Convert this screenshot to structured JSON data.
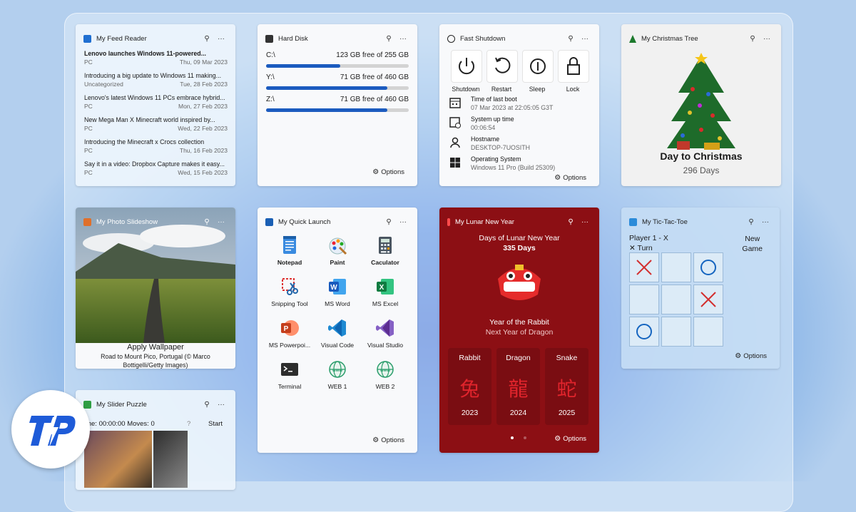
{
  "feed": {
    "title": "My Feed Reader",
    "items": [
      {
        "title": "Lenovo launches Windows 11-powered...",
        "cat": "PC",
        "date": "Thu, 09 Mar 2023"
      },
      {
        "title": "Introducing a big update to Windows 11 making...",
        "cat": "Uncategorized",
        "date": "Tue, 28 Feb 2023"
      },
      {
        "title": "Lenovo's latest Windows 11 PCs embrace hybrid...",
        "cat": "PC",
        "date": "Mon, 27 Feb 2023"
      },
      {
        "title": "New Mega Man X Minecraft world inspired by...",
        "cat": "PC",
        "date": "Wed, 22 Feb 2023"
      },
      {
        "title": "Introducing the Minecraft x Crocs collection",
        "cat": "PC",
        "date": "Thu, 16 Feb 2023"
      },
      {
        "title": "Say it in a video: Dropbox Capture makes it easy...",
        "cat": "PC",
        "date": "Wed, 15 Feb 2023"
      }
    ]
  },
  "disk": {
    "title": "Hard Disk",
    "drives": [
      {
        "name": "C:\\",
        "free": "123 GB free of 255 GB",
        "used_fraction": 0.52
      },
      {
        "name": "Y:\\",
        "free": "71 GB free of 460 GB",
        "used_fraction": 0.85
      },
      {
        "name": "Z:\\",
        "free": "71 GB free of 460 GB",
        "used_fraction": 0.85
      }
    ],
    "options": "Options"
  },
  "shutdown": {
    "title": "Fast Shutdown",
    "buttons": [
      "Shutdown",
      "Restart",
      "Sleep",
      "Lock"
    ],
    "info": [
      {
        "key": "Time of last boot",
        "value": "07 Mar 2023 at 22:05:05 G3T"
      },
      {
        "key": "System up time",
        "value": "00:06:54"
      },
      {
        "key": "Hostname",
        "value": "DESKTOP-7UOSITH"
      },
      {
        "key": "Operating System",
        "value": "Windows 11 Pro (Build 25309)"
      }
    ],
    "options": "Options"
  },
  "xmas": {
    "title": "My Christmas Tree",
    "label": "Day to Christmas",
    "days": "296 Days"
  },
  "slideshow": {
    "title": "My Photo Slideshow",
    "action": "Apply Wallpaper",
    "caption": "Road to Mount Pico, Portugal (© Marco Bottigelli/Getty Images)"
  },
  "launch": {
    "title": "My Quick Launch",
    "apps": [
      {
        "label": "Notepad",
        "icon": "notepad-icon"
      },
      {
        "label": "Paint",
        "icon": "paint-icon"
      },
      {
        "label": "Caculator",
        "icon": "calculator-icon"
      },
      {
        "label": "Snipping Tool",
        "icon": "snipping-tool-icon"
      },
      {
        "label": "MS Word",
        "icon": "word-icon"
      },
      {
        "label": "MS Excel",
        "icon": "excel-icon"
      },
      {
        "label": "MS Powerpoi...",
        "icon": "powerpoint-icon"
      },
      {
        "label": "Visual Code",
        "icon": "vscode-icon"
      },
      {
        "label": "Visual Studio",
        "icon": "visual-studio-icon"
      },
      {
        "label": "Terminal",
        "icon": "terminal-icon"
      },
      {
        "label": "WEB 1",
        "icon": "web-icon"
      },
      {
        "label": "WEB 2",
        "icon": "web-icon"
      }
    ],
    "options": "Options"
  },
  "lunar": {
    "title": "My Lunar New Year",
    "days_label": "Days of Lunar New Year",
    "days": "335 Days",
    "year_of": "Year of the Rabbit",
    "next_year": "Next Year of Dragon",
    "cards": [
      {
        "name": "Rabbit",
        "year": "2023",
        "glyph": "兔"
      },
      {
        "name": "Dragon",
        "year": "2024",
        "glyph": "龍"
      },
      {
        "name": "Snake",
        "year": "2025",
        "glyph": "蛇"
      }
    ],
    "options": "Options"
  },
  "ttt": {
    "title": "My Tic-Tac-Toe",
    "player": "Player 1 - X",
    "turn_mark": "✕",
    "turn": "Turn",
    "new_game_1": "New",
    "new_game_2": "Game",
    "board": [
      "X",
      "",
      "O",
      "",
      "",
      "X",
      "O",
      "",
      ""
    ],
    "options": "Options"
  },
  "slider": {
    "title": "My Slider Puzzle",
    "status": "ime: 00:00:00 Moves: 0",
    "help": "?",
    "start": "Start"
  },
  "logo": {
    "text": "TP",
    "color": "#1e5bd8"
  }
}
